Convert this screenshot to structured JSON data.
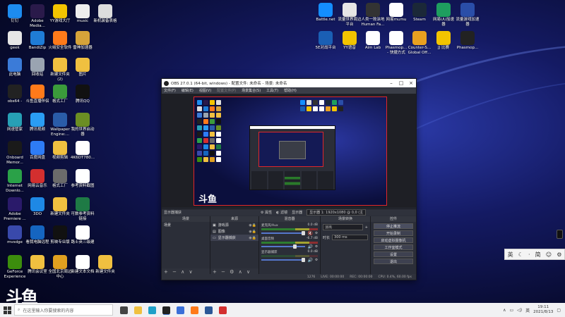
{
  "desktop": {
    "left_icons": [
      {
        "label": "钉钉",
        "icon": "dingtalk-icon",
        "color": "#1d8cf0"
      },
      {
        "label": "Adobe\nMedia...",
        "icon": "adobe-media-icon",
        "color": "#2a1a4a"
      },
      {
        "label": "YY游戏大厅",
        "icon": "yy-game-icon",
        "color": "#f3c400"
      },
      {
        "label": "music",
        "icon": "music-icon",
        "color": "#eeeeee"
      },
      {
        "label": "新机装备表格",
        "icon": "spreadsheet-icon",
        "color": "#dddddd"
      },
      {
        "label": "geek",
        "icon": "geek-icon",
        "color": "#e6e6e6"
      },
      {
        "label": "BandiZip",
        "icon": "bandizip-icon",
        "color": "#1f7cd6"
      },
      {
        "label": "火绒安全软件",
        "icon": "huorong-icon",
        "color": "#ff7a1a"
      },
      {
        "label": "雷神加速器",
        "icon": "leishen-icon",
        "color": "#d6a33a"
      },
      {
        "label": "此电脑",
        "icon": "this-pc-icon",
        "color": "#3b7bd8"
      },
      {
        "label": "回收站",
        "icon": "recycle-bin-icon",
        "color": "#9aa4b1"
      },
      {
        "label": "新建文件夹\n(2)",
        "icon": "folder-icon",
        "color": "#f0c040"
      },
      {
        "label": "图片",
        "icon": "folder-icon",
        "color": "#f0c040"
      },
      {
        "label": "obs64 -",
        "icon": "obs-icon",
        "color": "#222222"
      },
      {
        "label": "斗鱼直播伴侣",
        "icon": "douyu-icon",
        "color": "#ff7a1a"
      },
      {
        "label": "格式工厂",
        "icon": "format-factory-icon",
        "color": "#3b9b3b"
      },
      {
        "label": "腾讯QQ",
        "icon": "qq-icon",
        "color": "#111111"
      },
      {
        "label": "网速管家",
        "icon": "netspeed-icon",
        "color": "#27a0b5"
      },
      {
        "label": "腾讯视频",
        "icon": "tencent-video-icon",
        "color": "#2a9df4"
      },
      {
        "label": "Wallpaper\nEngine:...",
        "icon": "wallpaper-engine-icon",
        "color": "#2a5ca8"
      },
      {
        "label": "我的世界启动\n器",
        "icon": "minecraft-icon",
        "color": "#6b8e23"
      },
      {
        "label": "Onboard\nMemor...",
        "icon": "onboard-memory-icon",
        "color": "#1a1a1a"
      },
      {
        "label": "百度网盘",
        "icon": "baidu-netdisk-icon",
        "color": "#2e7cf6"
      },
      {
        "label": "视频剪辑",
        "icon": "video-edit-icon",
        "color": "#f0c040"
      },
      {
        "label": "4K6DT780...",
        "icon": "document-icon",
        "color": "#ffffff"
      },
      {
        "label": "Internet\nDownlo...",
        "icon": "idm-icon",
        "color": "#2aa148"
      },
      {
        "label": "网易云音乐",
        "icon": "netease-music-icon",
        "color": "#d32f2f"
      },
      {
        "label": "格式工厂",
        "icon": "format-factory-icon",
        "color": "#6b6b6b"
      },
      {
        "label": "参考资料截图",
        "icon": "document-icon",
        "color": "#ffffff"
      },
      {
        "label": "Adobe\nPremiere ...",
        "icon": "premiere-icon",
        "color": "#2a1a6a"
      },
      {
        "label": "3DO",
        "icon": "3do-icon",
        "color": "#1e88e5"
      },
      {
        "label": "新建文件夹",
        "icon": "folder-icon",
        "color": "#f0c040"
      },
      {
        "label": "可数参考资料\n链接",
        "icon": "excel-icon",
        "color": "#1e7a45"
      },
      {
        "label": "mvsdge",
        "icon": "mvsdge-icon",
        "color": "#3949ab"
      },
      {
        "label": "看我电脑远程",
        "icon": "remote-icon",
        "color": "#1565c0"
      },
      {
        "label": "剪映专业版",
        "icon": "jianying-icon",
        "color": "#111111"
      },
      {
        "label": "路士英三级建",
        "icon": "document-icon",
        "color": "#ffffff"
      },
      {
        "label": "GeForce\nExperience",
        "icon": "geforce-icon",
        "color": "#3c8d0d"
      },
      {
        "label": "腾讯会议室",
        "icon": "folder-icon",
        "color": "#f0c040"
      },
      {
        "label": "全国北京周边\n中心",
        "icon": "folder-icon",
        "color": "#e0a020"
      },
      {
        "label": "新建文本文档",
        "icon": "word-icon",
        "color": "#ffffff"
      },
      {
        "label": "新建文件夹",
        "icon": "folder-icon",
        "color": "#f0c040"
      }
    ],
    "right_icons": [
      {
        "label": "Battle.net",
        "icon": "battlenet-icon",
        "color": "#148eff"
      },
      {
        "label": "流量世界周边\n平台",
        "icon": "platform-icon",
        "color": "#e6e6e6"
      },
      {
        "label": "人类一败涂地\nHuman Fa...",
        "icon": "human-fall-icon",
        "color": "#333333"
      },
      {
        "label": "网易mumu",
        "icon": "mumu-icon",
        "color": "#ffffff"
      },
      {
        "label": "Steam",
        "icon": "steam-icon",
        "color": "#1b2838"
      },
      {
        "label": "网易UU加速\n器",
        "icon": "uu-icon",
        "color": "#1e9e5f"
      },
      {
        "label": "流量游戏加速\n器",
        "icon": "accelerator-icon",
        "color": "#2a4ea8"
      },
      {
        "label": "5E对战平台",
        "icon": "5e-icon",
        "color": "#1a5fb4"
      },
      {
        "label": "YY语音",
        "icon": "yy-voice-icon",
        "color": "#f3c400"
      },
      {
        "label": "Aim Lab",
        "icon": "aimlab-icon",
        "color": "#ffffff"
      },
      {
        "label": "Phasmop...\n- 快捷方式",
        "icon": "phasmophobia-icon",
        "color": "#ffffff"
      },
      {
        "label": "Counter-S...\nGlobal Off...",
        "icon": "csgo-icon",
        "color": "#e8a020"
      },
      {
        "label": "JJ 比赛",
        "icon": "jj-icon",
        "color": "#f3c400"
      },
      {
        "label": "Phasmop...",
        "icon": "phasmophobia-icon",
        "color": "#222222"
      }
    ]
  },
  "obs": {
    "title": "OBS 27.0.1 (64-bit, windows) - 配置文件: 未命名 - 场景: 未命名",
    "menu": [
      "文件(F)",
      "编辑(E)",
      "视图(V)",
      "配置文件(P)",
      "场景集合(S)",
      "工具(T)",
      "帮助(H)"
    ],
    "scene_bar": {
      "label": "显示器捕获",
      "properties": "属性",
      "filters": "滤镜",
      "display_label": "显示器",
      "display_value": "显示器 1: 1920x1080 @ 0,0 (主"
    },
    "docks": {
      "scenes": {
        "header": "场景",
        "items": [
          "场景"
        ]
      },
      "sources": {
        "header": "来源",
        "items": [
          "游戏源",
          "图像",
          "显示器捕获"
        ]
      },
      "mixer": {
        "header": "混音器",
        "channels": [
          {
            "name": "麦克风/Aux",
            "db": "0.0 dB",
            "muted": true
          },
          {
            "name": "桌面音频",
            "db": "-6.7 dB",
            "muted": false
          },
          {
            "name": "显示器捕获",
            "db": "0.0 dB",
            "muted": false
          }
        ]
      },
      "transitions": {
        "header": "场景转换",
        "type": "淡出",
        "duration_label": "时长",
        "duration": "300 ms"
      },
      "controls": {
        "header": "控件",
        "buttons": [
          "停止推流",
          "开始录制",
          "启动虚拟摄像机",
          "工作室模式",
          "设置",
          "退出"
        ]
      }
    },
    "status": {
      "live": "LIVE: 00:00:00",
      "rec": "REC: 00:00:00",
      "cpu": "CPU: 0.4%, 60.00 fps",
      "dropped": "1276"
    }
  },
  "watermark_text": "斗鱼",
  "ime": {
    "lang": "英",
    "punct": "·",
    "mode": "简"
  },
  "taskbar": {
    "search_placeholder": "在这里输入你要搜索的内容",
    "time": "19:11",
    "date": "2021/8/13",
    "apps": [
      {
        "name": "task-view-icon",
        "color": "#444444"
      },
      {
        "name": "file-explorer-icon",
        "color": "#f0c040"
      },
      {
        "name": "edge-icon",
        "color": "#1ea0c8"
      },
      {
        "name": "obs-taskbar-icon",
        "color": "#222222"
      },
      {
        "name": "store-icon",
        "color": "#3a6fd8"
      },
      {
        "name": "douyu-taskbar-icon",
        "color": "#ff7a1a"
      },
      {
        "name": "word-taskbar-icon",
        "color": "#2b5797"
      },
      {
        "name": "netease-taskbar-icon",
        "color": "#d32f2f"
      }
    ]
  }
}
